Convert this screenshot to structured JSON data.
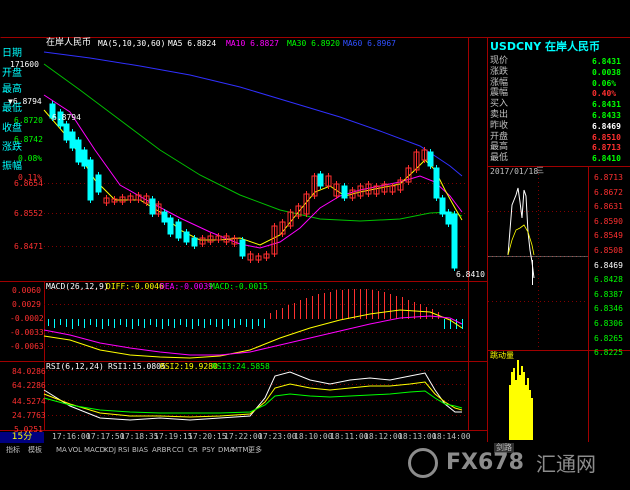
{
  "header": {
    "symbol_cn": "在岸人民币",
    "ma_label": "MA(5,10,30,60)",
    "ma5": "MA5 6.8824",
    "ma10": "MA10 6.8827",
    "ma30": "MA30 6.8920",
    "ma60": "MA60 6.8967"
  },
  "left_info": {
    "date_label": "日期",
    "date_value": "171600",
    "open_label": "开盘",
    "open_value": "",
    "high_label": "最高",
    "high_value": "▼6.8794",
    "low_label": "最低",
    "low_value": "6.8720",
    "close_label": "收盘",
    "close_value": "6.8742",
    "change_label": "涨跌",
    "change_value": "0.08%",
    "amp_label": "振幅",
    "amp_value": "0.11%"
  },
  "price_axis": [
    "6.8794",
    "6.8654",
    "6.8552",
    "6.8471"
  ],
  "annotations": {
    "high_marker": "6.8794",
    "low_marker": "6.8410"
  },
  "macd": {
    "title": "MACD(26,12,9)",
    "diff": "DIFF:-0.0046",
    "dea": "DEA:-0.0039",
    "macd": "MACD:-0.0015",
    "axis": [
      "0.0060",
      "0.0029",
      "-0.0002",
      "-0.0033",
      "-0.0063"
    ]
  },
  "rsi": {
    "title": "RSI(6,12,24)",
    "rsi1": "RSI1:15.0805",
    "rsi2": "RSI2:19.9280",
    "rsi3": "RSI3:24.5858",
    "axis": [
      "84.0286",
      "64.2286",
      "44.5274",
      "24.7763",
      "5.0251"
    ]
  },
  "time_axis": [
    "17:16:00",
    "17:17:50",
    "17:18:35",
    "17:19:15",
    "17:20:15",
    "17:22:00",
    "17:23:00",
    "18:10:00",
    "18:11:00",
    "18:12:00",
    "18:13:00",
    "18:14:00"
  ],
  "period": "15分",
  "indicator_tabs": [
    "指标",
    "模板",
    "MA",
    "VOL",
    "MACD",
    "KDJ",
    "RSI",
    "BIAS",
    "ARBR",
    "CCI",
    "CR",
    "PSY",
    "DMA",
    "MTM",
    "更多"
  ],
  "quote_panel": {
    "title": "USDCNY 在岸人民币",
    "rows": [
      {
        "label": "现价",
        "value": "6.8431",
        "color": "#00ff00"
      },
      {
        "label": "涨跌",
        "value": "0.0038",
        "color": "#00ff00"
      },
      {
        "label": "涨幅",
        "value": "0.06%",
        "color": "#00ff00"
      },
      {
        "label": "震幅",
        "value": "0.40%",
        "color": "#ff3030"
      },
      {
        "label": "买入",
        "value": "6.8431",
        "color": "#00ff00"
      },
      {
        "label": "卖出",
        "value": "6.8433",
        "color": "#00ff00"
      },
      {
        "label": "昨收",
        "value": "6.8469",
        "color": "#ffffff"
      },
      {
        "label": "开盘",
        "value": "6.8510",
        "color": "#ff3030"
      },
      {
        "label": "最高",
        "value": "6.8713",
        "color": "#ff3030"
      },
      {
        "label": "最低",
        "value": "6.8410",
        "color": "#00ff00"
      }
    ]
  },
  "mini_chart": {
    "date": "2017/01/18",
    "weekday": "三",
    "axis": [
      {
        "v": "6.8713",
        "c": "#ff3030"
      },
      {
        "v": "6.8672",
        "c": "#ff3030"
      },
      {
        "v": "6.8631",
        "c": "#ff3030"
      },
      {
        "v": "6.8590",
        "c": "#ff3030"
      },
      {
        "v": "6.8549",
        "c": "#ff3030"
      },
      {
        "v": "6.8508",
        "c": "#ff3030"
      },
      {
        "v": "6.8469",
        "c": "#ffffff"
      },
      {
        "v": "6.8428",
        "c": "#00ff00"
      },
      {
        "v": "6.8387",
        "c": "#00ff00"
      },
      {
        "v": "6.8346",
        "c": "#00ff00"
      },
      {
        "v": "6.8306",
        "c": "#00ff00"
      },
      {
        "v": "6.8265",
        "c": "#00ff00"
      },
      {
        "v": "6.8225",
        "c": "#00ff00"
      }
    ],
    "momentum_label": "跳动量",
    "bottom_label": "剑路"
  },
  "watermark": {
    "text": "FX678",
    "cn": "汇通网"
  },
  "colors": {
    "up": "#ff3030",
    "down": "#00ffff",
    "ma5": "#ffffff",
    "ma10": "#ffff00",
    "ma30": "#ff00ff",
    "ma60": "#00ff00",
    "grid": "#800000"
  }
}
